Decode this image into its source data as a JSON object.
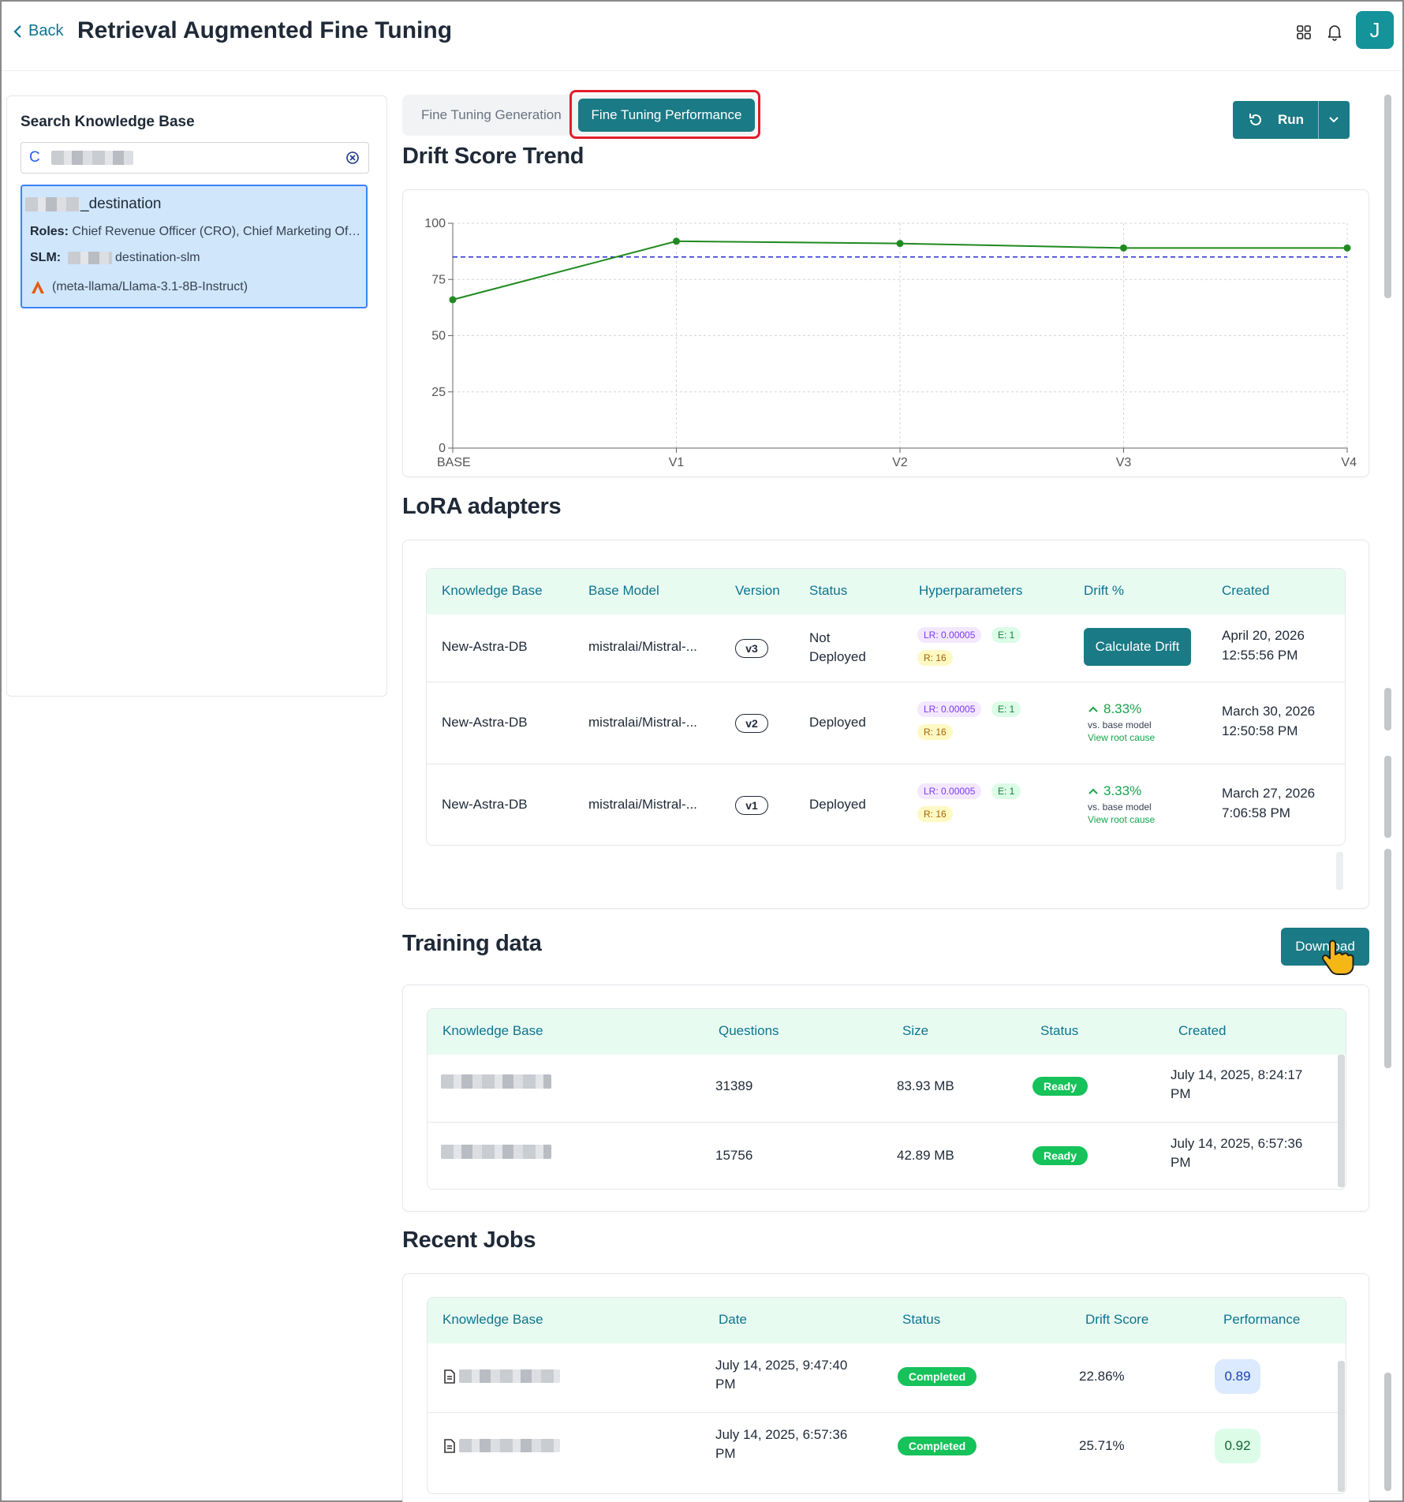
{
  "header": {
    "back_label": "Back",
    "title": "Retrieval Augmented Fine Tuning",
    "icons": [
      "grid-icon",
      "bell-icon"
    ],
    "avatar_initial": "J"
  },
  "sidebar": {
    "title": "Search Knowledge Base",
    "search_value": "C",
    "kb_card": {
      "name_suffix": "_destination",
      "roles_label": "Roles:",
      "roles_value": "Chief Revenue Officer (CRO), Chief Marketing Officer (CMO)",
      "slm_label": "SLM:",
      "slm_value": "destination-slm",
      "model": "(meta-llama/Llama-3.1-8B-Instruct)"
    }
  },
  "tabs": {
    "generation": "Fine Tuning Generation",
    "performance": "Fine Tuning Performance"
  },
  "run_button": "Run",
  "drift": {
    "title": "Drift Score Trend"
  },
  "chart_data": {
    "type": "line",
    "categories": [
      "BASE",
      "V1",
      "V2",
      "V3",
      "V4"
    ],
    "values": [
      66,
      92,
      91,
      89,
      89
    ],
    "threshold": 85,
    "ylim": [
      0,
      100
    ],
    "yticks": [
      0,
      25,
      50,
      75,
      100
    ],
    "title": "",
    "xlabel": "",
    "ylabel": "",
    "grid": true,
    "colors": {
      "line": "#1f8a1f",
      "threshold": "#2a2ad6"
    }
  },
  "lora": {
    "title": "LoRA adapters",
    "columns": [
      "Knowledge Base",
      "Base Model",
      "Version",
      "Status",
      "Hyperparameters",
      "Drift %",
      "Created"
    ],
    "rows": [
      {
        "kb": "New-Astra-DB",
        "model": "mistralai/Mistral-...",
        "version": "v3",
        "status": "Not Deployed",
        "lr": "LR: 0.00005",
        "e": "E: 1",
        "r": "R: 16",
        "drift_button": "Calculate Drift",
        "created_date": "April 20, 2026",
        "created_time": "12:55:56 PM"
      },
      {
        "kb": "New-Astra-DB",
        "model": "mistralai/Mistral-...",
        "version": "v2",
        "status": "Deployed",
        "lr": "LR: 0.00005",
        "e": "E: 1",
        "r": "R: 16",
        "drift": "8.33%",
        "drift_sub": "vs. base model",
        "root_cause": "View root cause",
        "created_date": "March 30, 2026",
        "created_time": "12:50:58 PM"
      },
      {
        "kb": "New-Astra-DB",
        "model": "mistralai/Mistral-...",
        "version": "v1",
        "status": "Deployed",
        "lr": "LR: 0.00005",
        "e": "E: 1",
        "r": "R: 16",
        "drift": "3.33%",
        "drift_sub": "vs. base model",
        "root_cause": "View root cause",
        "created_date": "March 27, 2026",
        "created_time": "7:06:58 PM"
      }
    ]
  },
  "training": {
    "title": "Training data",
    "download_label": "Download",
    "columns": [
      "Knowledge Base",
      "Questions",
      "Size",
      "Status",
      "Created"
    ],
    "rows": [
      {
        "questions": "31389",
        "size": "83.93 MB",
        "status": "Ready",
        "created_l1": "July 14, 2025, 8:24:17",
        "created_l2": "PM"
      },
      {
        "questions": "15756",
        "size": "42.89 MB",
        "status": "Ready",
        "created_l1": "July 14, 2025, 6:57:36",
        "created_l2": "PM"
      }
    ]
  },
  "jobs": {
    "title": "Recent Jobs",
    "columns": [
      "Knowledge Base",
      "Date",
      "Status",
      "Drift Score",
      "Performance"
    ],
    "rows": [
      {
        "date_l1": "July 14, 2025, 9:47:40",
        "date_l2": "PM",
        "status": "Completed",
        "drift": "22.86%",
        "performance": "0.89"
      },
      {
        "date_l1": "July 14, 2025, 6:57:36",
        "date_l2": "PM",
        "status": "Completed",
        "drift": "25.71%",
        "performance": "0.92"
      }
    ]
  }
}
